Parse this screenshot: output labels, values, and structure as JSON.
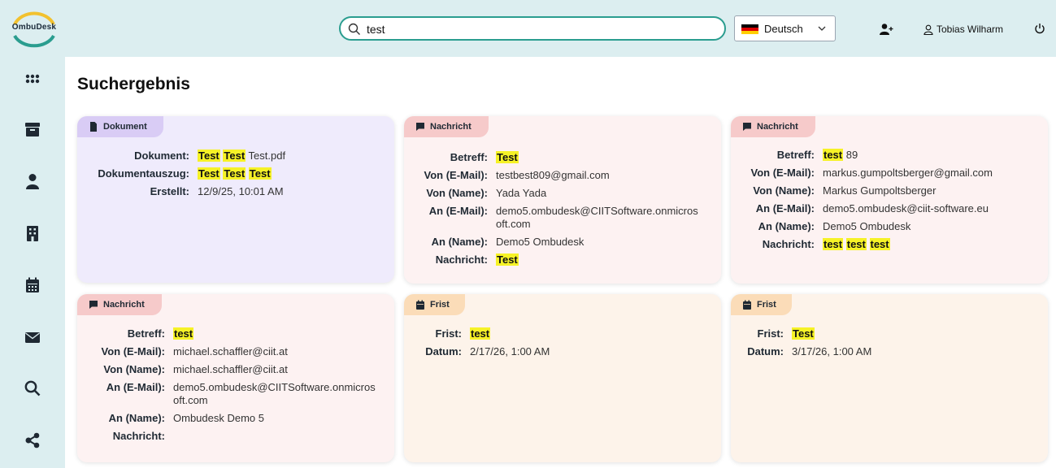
{
  "app": {
    "logo_text": "OmbuDesk"
  },
  "search": {
    "value": "test"
  },
  "language": {
    "selected": "Deutsch"
  },
  "user": {
    "name": "Tobias Wilharm"
  },
  "page": {
    "title": "Suchergebnis"
  },
  "cards": [
    {
      "type": "Dokument",
      "rows": [
        {
          "label": "Dokument:",
          "value": "Test Test Test.pdf"
        },
        {
          "label": "Dokumentauszug:",
          "value": "Test Test Test"
        },
        {
          "label": "Erstellt:",
          "value": "12/9/25, 10:01 AM"
        }
      ]
    },
    {
      "type": "Nachricht",
      "rows": [
        {
          "label": "Betreff:",
          "value": "Test"
        },
        {
          "label": "Von (E-Mail):",
          "value": "testbest809@gmail.com"
        },
        {
          "label": "Von (Name):",
          "value": "Yada Yada"
        },
        {
          "label": "An (E-Mail):",
          "value": "demo5.ombudesk@CIITSoftware.onmicrosoft.com"
        },
        {
          "label": "An (Name):",
          "value": "Demo5 Ombudesk"
        },
        {
          "label": "Nachricht:",
          "value": "Test"
        }
      ]
    },
    {
      "type": "Nachricht",
      "rows": [
        {
          "label": "Betreff:",
          "value": "test 89"
        },
        {
          "label": "Von (E-Mail):",
          "value": "markus.gumpoltsberger@gmail.com"
        },
        {
          "label": "Von (Name):",
          "value": "Markus Gumpoltsberger"
        },
        {
          "label": "An (E-Mail):",
          "value": "demo5.ombudesk@ciit-software.eu"
        },
        {
          "label": "An (Name):",
          "value": "Demo5 Ombudesk"
        },
        {
          "label": "Nachricht:",
          "value": "test test test"
        }
      ]
    },
    {
      "type": "Nachricht",
      "rows": [
        {
          "label": "Betreff:",
          "value": "test"
        },
        {
          "label": "Von (E-Mail):",
          "value": "michael.schaffler@ciit.at"
        },
        {
          "label": "Von (Name):",
          "value": "michael.schaffler@ciit.at"
        },
        {
          "label": "An (E-Mail):",
          "value": "demo5.ombudesk@CIITSoftware.onmicrosoft.com"
        },
        {
          "label": "An (Name):",
          "value": "Ombudesk Demo 5"
        },
        {
          "label": "Nachricht:",
          "value": ""
        }
      ]
    },
    {
      "type": "Frist",
      "rows": [
        {
          "label": "Frist:",
          "value": "test"
        },
        {
          "label": "Datum:",
          "value": "2/17/26, 1:00 AM"
        }
      ]
    },
    {
      "type": "Frist",
      "rows": [
        {
          "label": "Frist:",
          "value": "Test"
        },
        {
          "label": "Datum:",
          "value": "3/17/26, 1:00 AM"
        }
      ]
    }
  ],
  "colors": {
    "accent": "#2a9d8f",
    "highlight": "#f6f227",
    "sidebar_bg": "#dceef0"
  },
  "icons": [
    "apps-icon",
    "archive-icon",
    "person-icon",
    "building-icon",
    "calendar-icon",
    "mail-icon",
    "search-icon",
    "share-icon"
  ]
}
